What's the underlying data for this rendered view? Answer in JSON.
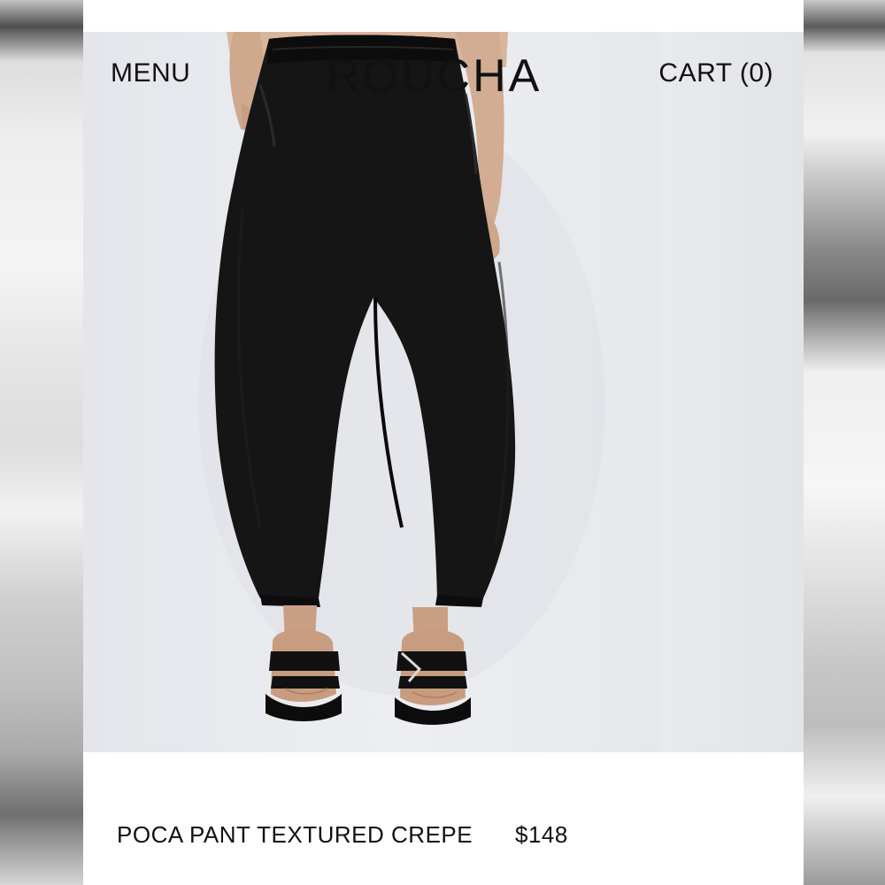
{
  "header": {
    "menu_label": "MENU",
    "logo": "ROUCHA",
    "cart_label": "CART (0)"
  },
  "product": {
    "name": "POCA PANT TEXTURED CREPE",
    "price": "$148",
    "image_description_icon": "product-photo"
  },
  "colors": {
    "text": "#111111",
    "background": "#ffffff",
    "gallery_bg": "#e9ebef",
    "garment": "#141414"
  }
}
